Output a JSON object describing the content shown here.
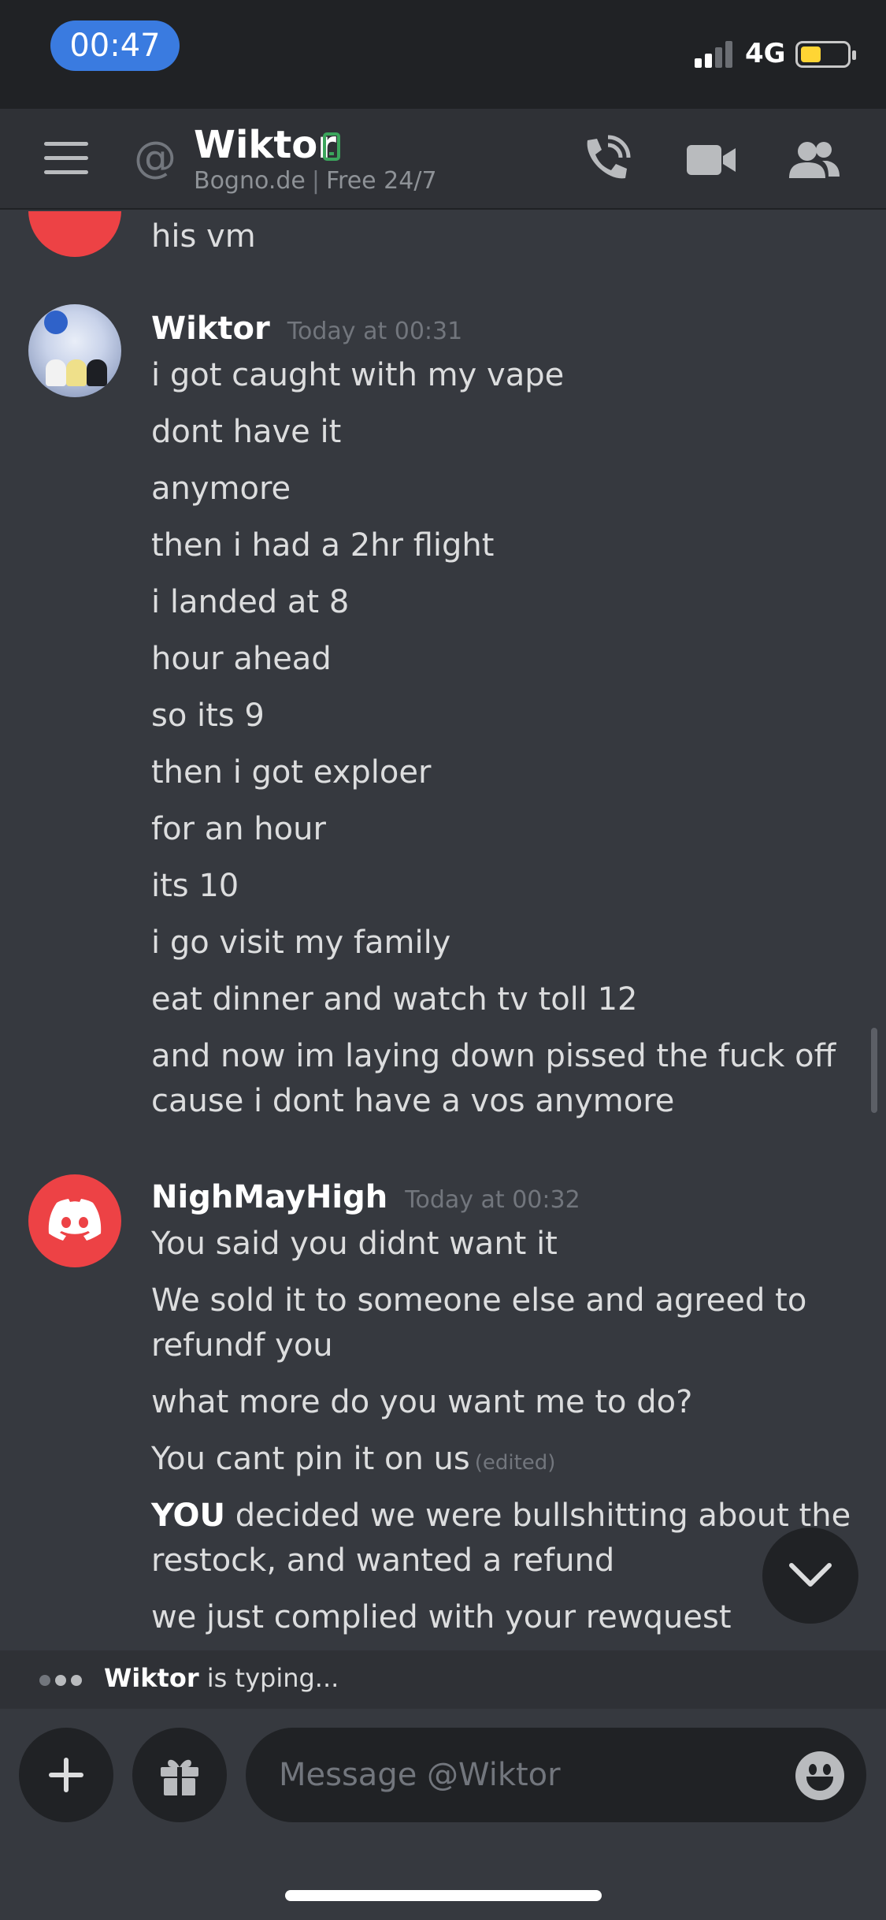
{
  "status_bar": {
    "time": "00:47",
    "network": "4G",
    "battery_level": 0.45
  },
  "header": {
    "title": "Wiktor",
    "subtitle_left": "Bogno.de",
    "subtitle_sep": "|",
    "subtitle_right": "Free 24/7",
    "online_status_color": "#3ba55c",
    "icons": [
      "menu-icon",
      "at-icon",
      "mobile-status-icon",
      "voice-call-icon",
      "video-call-icon",
      "members-icon"
    ]
  },
  "messages": {
    "previous_tail": "his vm",
    "groups": [
      {
        "author": "Wiktor",
        "timestamp": "Today at 00:31",
        "lines": [
          "i got caught with my vape",
          "dont have it",
          "anymore",
          "then i had a 2hr flight",
          "i landed at 8",
          "hour ahead",
          "so its 9",
          "then i got exploer",
          "for an hour",
          "its 10",
          "i go visit my family",
          "eat dinner and watch tv toll 12",
          "and now im laying down pissed the fuck off",
          "cause i dont have a vos anymore"
        ]
      },
      {
        "author": "NighMayHigh",
        "timestamp": "Today at 00:32",
        "lines": [
          "You said you didnt want it",
          "We sold it to someone else and agreed to",
          "refundf you",
          "what more do you want me to do?",
          "You cant pin it on us",
          "decided we were bullshitting about the",
          "restock, and wanted a refund",
          "we just complied with your rewquest"
        ],
        "edited_label": "(edited)",
        "bold_word": "YOU"
      }
    ]
  },
  "typing": {
    "user": "Wiktor",
    "text": " is typing..."
  },
  "composer": {
    "placeholder": "Message @Wiktor"
  },
  "colors": {
    "background": "#36393f",
    "header": "#2f3136",
    "accent_blue": "#3a7be0",
    "discord_red": "#ed4245"
  }
}
